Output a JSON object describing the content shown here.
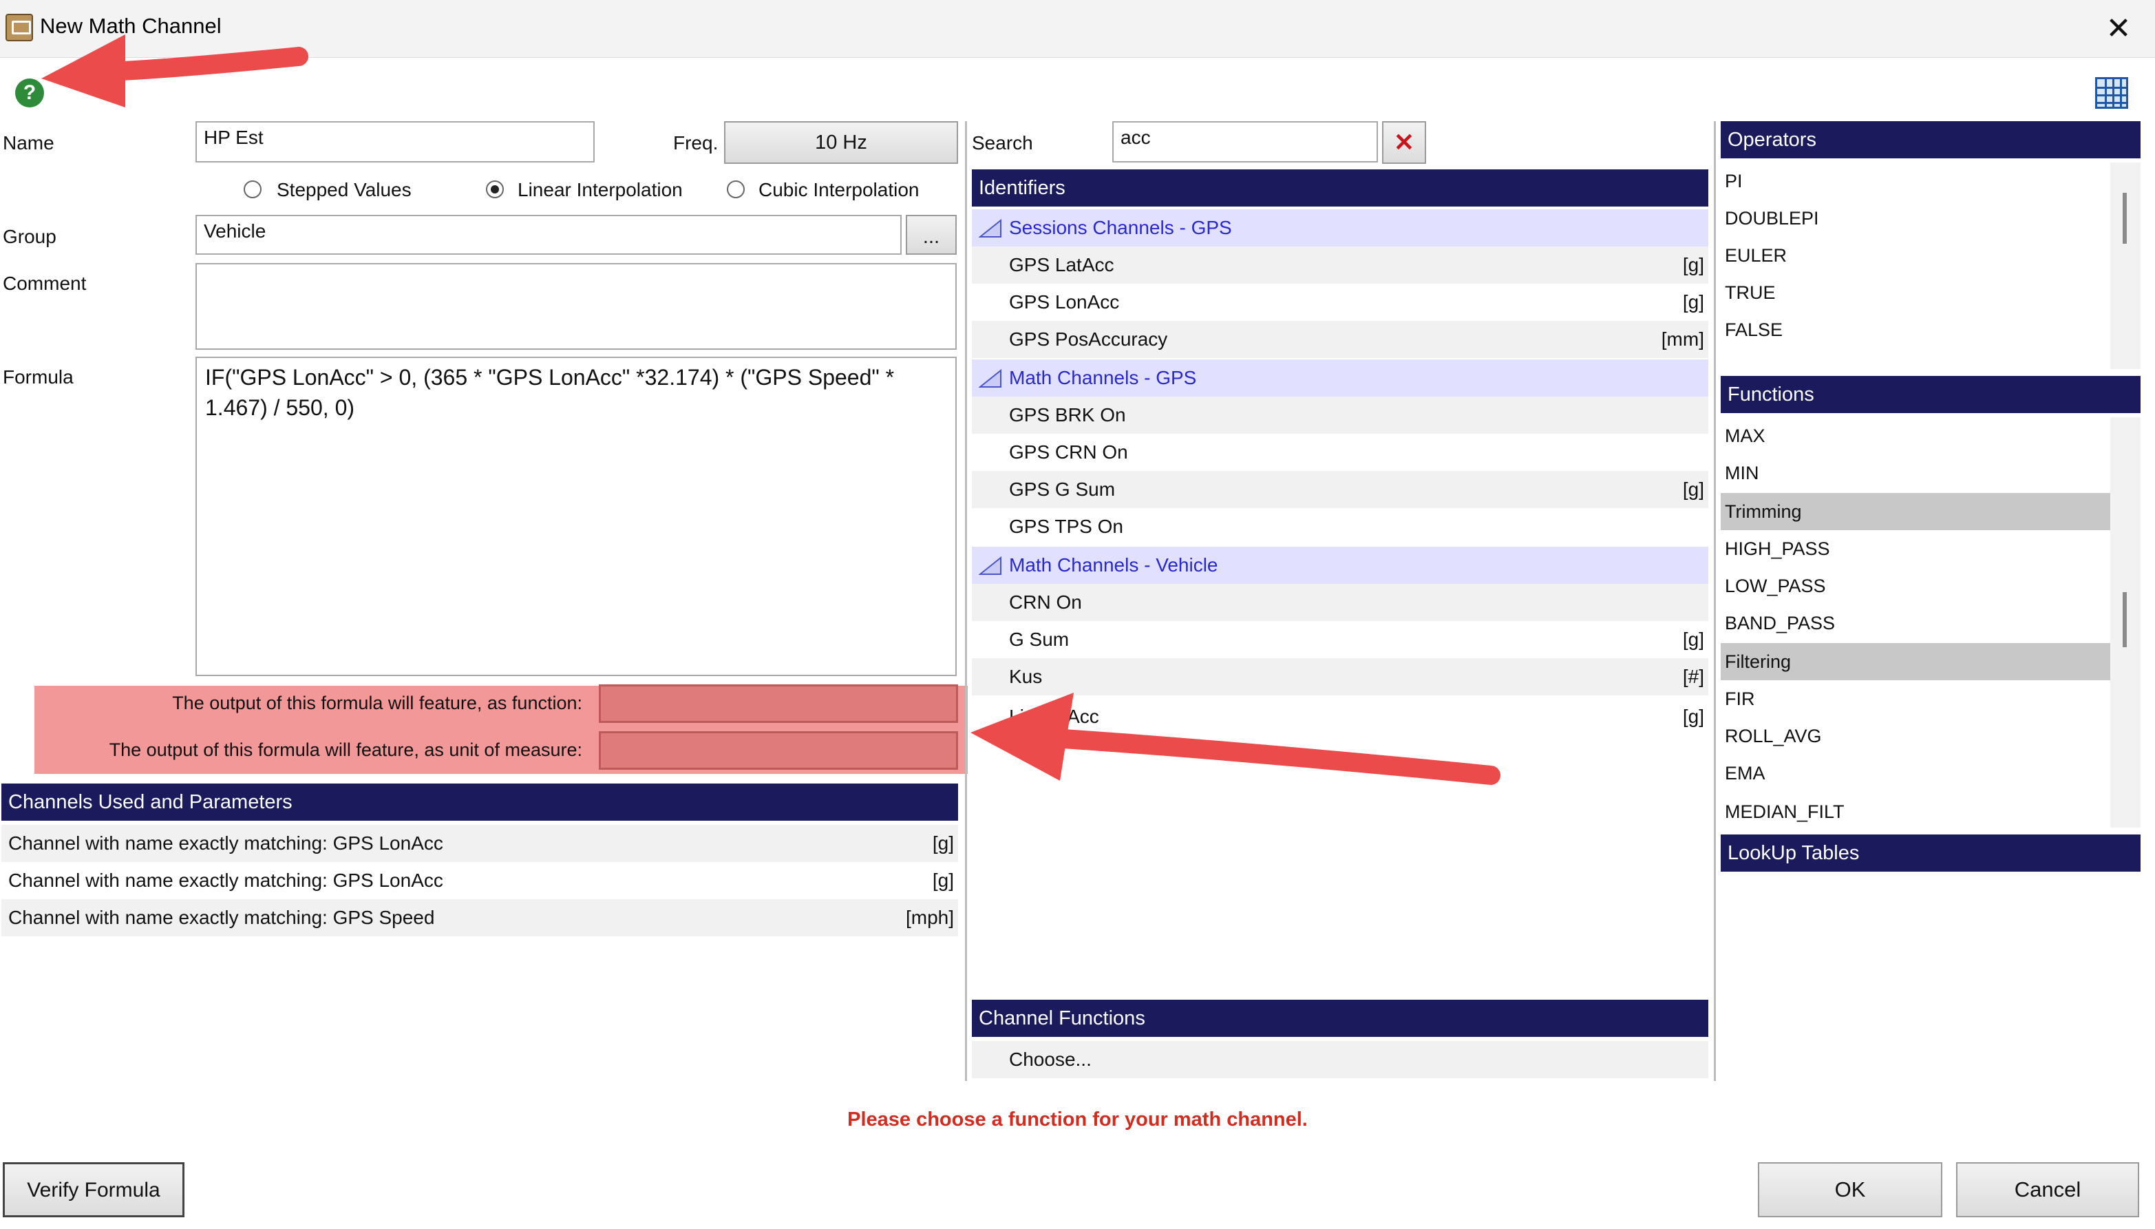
{
  "window": {
    "title": "New Math Channel",
    "close_glyph": "✕"
  },
  "toolbar": {
    "help_icon": "?",
    "grid_icon": "table-grid"
  },
  "form": {
    "name_label": "Name",
    "name_value": "HP Est",
    "freq_label": "Freq.",
    "freq_value": "10 Hz",
    "radios": [
      {
        "label": "Stepped Values",
        "checked": false
      },
      {
        "label": "Linear Interpolation",
        "checked": true
      },
      {
        "label": "Cubic Interpolation",
        "checked": false
      }
    ],
    "group_label": "Group",
    "group_value": "Vehicle",
    "group_browse": "...",
    "comment_label": "Comment",
    "comment_value": "",
    "formula_label": "Formula",
    "formula_value": "IF(\"GPS LonAcc\" > 0, (365 * \"GPS LonAcc\" *32.174) * (\"GPS Speed\" * 1.467) / 550, 0)"
  },
  "output": {
    "function_label": "The output of this formula will feature, as function:",
    "unit_label": "The output of this formula will feature, as unit of measure:"
  },
  "channels_used": {
    "header": "Channels Used and Parameters",
    "rows": [
      {
        "text": "Channel with name exactly matching: GPS LonAcc",
        "unit": "[g]"
      },
      {
        "text": "Channel with name exactly matching: GPS LonAcc",
        "unit": "[g]"
      },
      {
        "text": "Channel with name exactly matching: GPS Speed",
        "unit": "[mph]"
      }
    ]
  },
  "search": {
    "label": "Search",
    "value": "acc",
    "clear_glyph": "✕"
  },
  "identifiers": {
    "header": "Identifiers",
    "groups": [
      {
        "name": "Sessions Channels - GPS",
        "items": [
          {
            "label": "GPS LatAcc",
            "unit": "[g]"
          },
          {
            "label": "GPS LonAcc",
            "unit": "[g]"
          },
          {
            "label": "GPS PosAccuracy",
            "unit": "[mm]"
          }
        ]
      },
      {
        "name": "Math Channels - GPS",
        "items": [
          {
            "label": "GPS BRK On",
            "unit": ""
          },
          {
            "label": "GPS CRN On",
            "unit": ""
          },
          {
            "label": "GPS G Sum",
            "unit": "[g]"
          },
          {
            "label": "GPS TPS On",
            "unit": ""
          }
        ]
      },
      {
        "name": "Math Channels - Vehicle",
        "items": [
          {
            "label": "CRN On",
            "unit": ""
          },
          {
            "label": "G Sum",
            "unit": "[g]"
          },
          {
            "label": "Kus",
            "unit": "[#]"
          },
          {
            "label": "Linear Acc",
            "unit": "[g]"
          }
        ]
      }
    ]
  },
  "channel_functions": {
    "header": "Channel Functions",
    "choose": "Choose..."
  },
  "operators": {
    "header": "Operators",
    "items": [
      "PI",
      "DOUBLEPI",
      "EULER",
      "TRUE",
      "FALSE"
    ]
  },
  "functions": {
    "header": "Functions",
    "items": [
      {
        "label": "MAX",
        "category": false
      },
      {
        "label": "MIN",
        "category": false
      },
      {
        "label": "Trimming",
        "category": true
      },
      {
        "label": "HIGH_PASS",
        "category": false
      },
      {
        "label": "LOW_PASS",
        "category": false
      },
      {
        "label": "BAND_PASS",
        "category": false
      },
      {
        "label": "Filtering",
        "category": true
      },
      {
        "label": "FIR",
        "category": false
      },
      {
        "label": "ROLL_AVG",
        "category": false
      },
      {
        "label": "EMA",
        "category": false
      },
      {
        "label": "MEDIAN_FILT",
        "category": false
      }
    ]
  },
  "lookup": {
    "header": "LookUp Tables"
  },
  "status": {
    "message": "Please choose a function for your math channel."
  },
  "footer": {
    "verify": "Verify Formula",
    "ok": "OK",
    "cancel": "Cancel"
  },
  "colors": {
    "accent_header": "#1a1a5c",
    "group_text": "#2828d0",
    "error": "#d02c20",
    "annotation": "#ec4b4b"
  }
}
